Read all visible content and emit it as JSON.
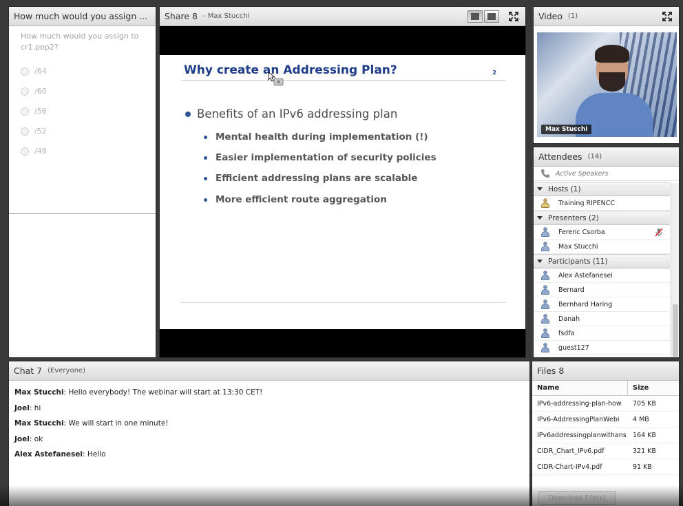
{
  "colors": {
    "slide_title": "#1f3c88",
    "bullet": "#2f5597",
    "pod_border": "#2a2a2a"
  },
  "poll": {
    "title": "How much would you assign ...",
    "question": "How much would you assign to cr1.pop2?",
    "options": [
      "/64",
      "/60",
      "/56",
      "/52",
      "/48"
    ]
  },
  "share": {
    "title": "Share 8",
    "presenter": "- Max Stucchi",
    "slide": {
      "title": "Why create an Addressing Plan?",
      "page_number": "2",
      "main_bullet": "Benefits of an IPv6 addressing plan",
      "sub_bullets": [
        "Mental health during implementation (!)",
        "Easier implementation of security policies",
        "Efficient addressing plans are scalable",
        "More efficient route aggregation"
      ]
    }
  },
  "video": {
    "title": "Video",
    "count": "(1)",
    "name": "Max Stucchi"
  },
  "attendees": {
    "title": "Attendees",
    "count": "(14)",
    "active_speakers": "Active Speakers",
    "hosts": {
      "label": "Hosts (1)",
      "people": [
        "Training RIPENCC"
      ]
    },
    "presenters": {
      "label": "Presenters (2)",
      "people": [
        "Ferenc Csorba",
        "Max Stucchi"
      ]
    },
    "participants": {
      "label": "Participants (11)",
      "people": [
        "Alex Astefanesei",
        "Bernard",
        "Bernhard Haring",
        "Danah",
        "fsdfa",
        "guest127"
      ]
    }
  },
  "chat": {
    "title": "Chat 7",
    "scope": "(Everyone)",
    "messages": [
      {
        "sender": "Max Stucchi",
        "text": "Hello everybody!  The webinar will start at 13:30 CET!"
      },
      {
        "sender": "Joel",
        "text": "hi"
      },
      {
        "sender": "Max Stucchi",
        "text": "We will start in one minute!"
      },
      {
        "sender": "Joel",
        "text": "ok"
      },
      {
        "sender": "Alex Astefanesei",
        "text": "Hello"
      }
    ]
  },
  "files": {
    "title": "Files 8",
    "col_name": "Name",
    "col_size": "Size",
    "rows": [
      {
        "name": "IPv6-addressing-plan-how",
        "size": "705 KB"
      },
      {
        "name": "IPv6-AddressingPlanWebi",
        "size": "4 MB"
      },
      {
        "name": "IPv6addressingplanwithans",
        "size": "164 KB"
      },
      {
        "name": "CIDR_Chart_IPv6.pdf",
        "size": "321 KB"
      },
      {
        "name": "CIDR-Chart-IPv4.pdf",
        "size": "91 KB"
      }
    ],
    "download_label": "Download File(s)"
  }
}
